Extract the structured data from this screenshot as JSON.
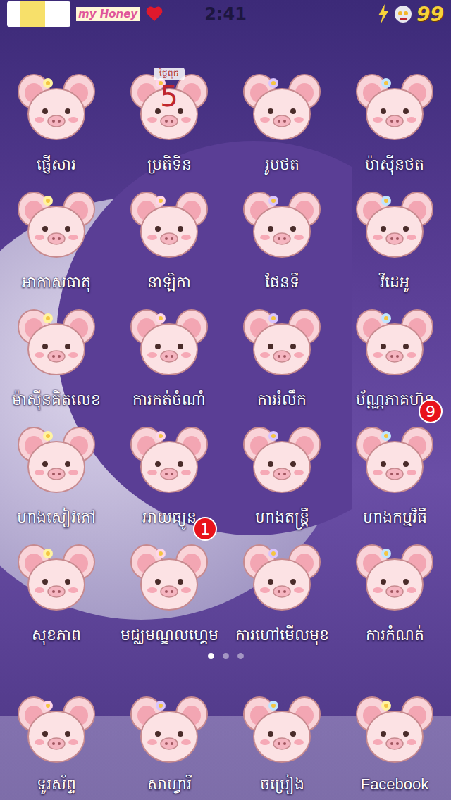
{
  "status_bar": {
    "caption": "my Honey",
    "time": "2:41",
    "battery": "99"
  },
  "apps": [
    {
      "label": "ផ្ញើសារ"
    },
    {
      "label": "ប្រតិទិន",
      "calendar": {
        "weekday": "ថ្ងៃពុធ",
        "day": "5"
      }
    },
    {
      "label": "រូបថត"
    },
    {
      "label": "ម៉ាស៊ីនថត"
    },
    {
      "label": "អាកាសធាតុ"
    },
    {
      "label": "នាឡិកា"
    },
    {
      "label": "ផែនទី"
    },
    {
      "label": "វីដេអូ"
    },
    {
      "label": "ម៉ាស៊ីនគិតលេខ"
    },
    {
      "label": "ការកត់ចំណាំ"
    },
    {
      "label": "ការរំលឹក"
    },
    {
      "label": "ប័ណ្ណភាគហ៊ុន"
    },
    {
      "label": "ហាងសៀវភៅ"
    },
    {
      "label": "អាយធ្យូន"
    },
    {
      "label": "ហាងតន្ត្រី"
    },
    {
      "label": "ហាងកម្មវិធី",
      "badge": "9"
    },
    {
      "label": "សុខភាព"
    },
    {
      "label": "មជ្ឈមណ្ឌលហ្គេម",
      "badge": "1"
    },
    {
      "label": "ការហៅមើលមុខ"
    },
    {
      "label": "ការកំណត់"
    }
  ],
  "page_dots": [
    {
      "selected": true
    },
    {
      "selected": false
    },
    {
      "selected": false
    }
  ],
  "dock": [
    {
      "label": "ទូរស័ព្ទ"
    },
    {
      "label": "សាហ្វារី"
    },
    {
      "label": "ចម្រៀង"
    },
    {
      "label": "Facebook"
    }
  ]
}
